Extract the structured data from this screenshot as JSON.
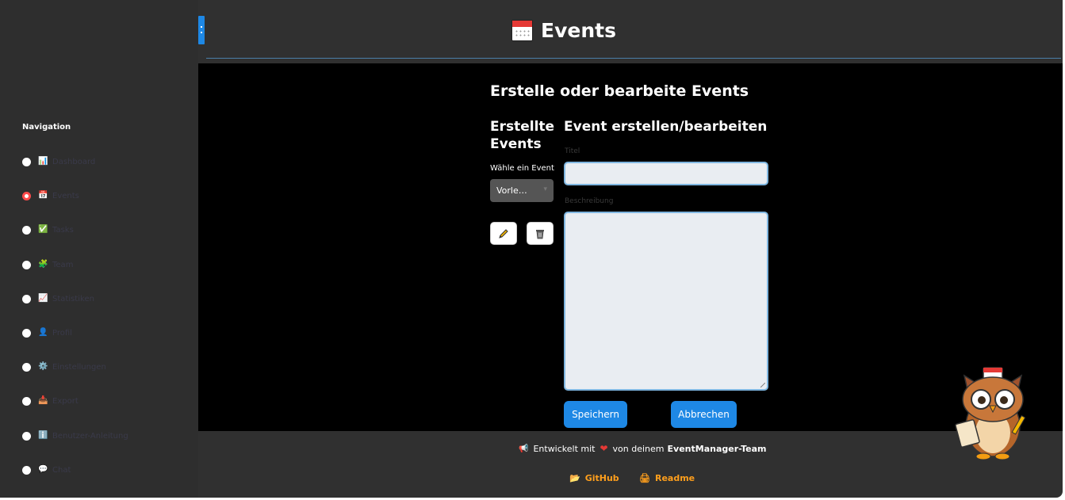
{
  "header": {
    "title": "Events",
    "title_icon": "calendar-icon"
  },
  "sidebar": {
    "title": "Navigation",
    "items": [
      {
        "icon": "bar-chart-icon",
        "emoji": "📊",
        "label": "Dashboard",
        "selected": false
      },
      {
        "icon": "calendar-icon",
        "emoji": "📅",
        "label": "Events",
        "selected": true
      },
      {
        "icon": "check-mark-icon",
        "emoji": "✅",
        "label": "Tasks",
        "selected": false
      },
      {
        "icon": "puzzle-icon",
        "emoji": "🧩",
        "label": "Team",
        "selected": false
      },
      {
        "icon": "trend-icon",
        "emoji": "📈",
        "label": "Statistiken",
        "selected": false
      },
      {
        "icon": "user-icon",
        "emoji": "👤",
        "label": "Profil",
        "selected": false
      },
      {
        "icon": "gear-icon",
        "emoji": "⚙️",
        "label": "Einstellungen",
        "selected": false
      },
      {
        "icon": "inbox-icon",
        "emoji": "📥",
        "label": "Export",
        "selected": false
      },
      {
        "icon": "info-icon",
        "emoji": "ℹ️",
        "label": "Benutzer-Anleitung",
        "selected": false
      },
      {
        "icon": "chat-icon",
        "emoji": "💬",
        "label": "Chat",
        "selected": false
      }
    ]
  },
  "main": {
    "heading": "Erstelle oder bearbeite Events",
    "left_column": {
      "heading": "Erstellte Events",
      "select_label": "Wähle ein Event",
      "select_value": "Vorle…"
    },
    "form": {
      "heading": "Event erstellen/bearbeiten",
      "title_label": "Titel",
      "title_value": "",
      "description_label": "Beschreibung",
      "description_value": "",
      "save_label": "Speichern",
      "cancel_label": "Abbrechen"
    }
  },
  "footer": {
    "prefix": "Entwickelt mit",
    "middle": "von deinem",
    "team": "EventManager-Team",
    "github_label": "GitHub",
    "readme_label": "Readme"
  },
  "colors": {
    "accent": "#1e88e5",
    "selected_radio": "#ff4b4b",
    "link": "#ff9f1c",
    "background": "#303030"
  }
}
